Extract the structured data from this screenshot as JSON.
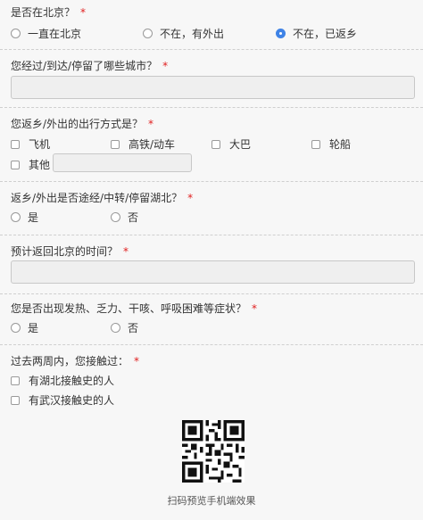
{
  "q1": {
    "title": "是否在北京？",
    "required": "*",
    "options": [
      "一直在北京",
      "不在，有外出",
      "不在，已返乡"
    ]
  },
  "q2": {
    "title": "您经过/到达/停留了哪些城市？",
    "required": "*",
    "value": ""
  },
  "q3": {
    "title": "您返乡/外出的出行方式是？",
    "required": "*",
    "options": [
      "飞机",
      "高铁/动车",
      "大巴",
      "轮船"
    ],
    "other": "其他",
    "other_value": ""
  },
  "q4": {
    "title": "返乡/外出是否途经/中转/停留湖北？",
    "required": "*",
    "options": [
      "是",
      "否"
    ]
  },
  "q5": {
    "title": "预计返回北京的时间？",
    "required": "*",
    "value": ""
  },
  "q6": {
    "title": "您是否出现发热、乏力、干咳、呼吸困难等症状？",
    "required": "*",
    "options": [
      "是",
      "否"
    ]
  },
  "q7": {
    "title": "过去两周内，您接触过：",
    "required": "*",
    "options": [
      "有湖北接触史的人",
      "有武汉接触史的人"
    ]
  },
  "qr": {
    "caption": "扫码预览手机端效果"
  },
  "colors": {
    "accent": "#3f83e6",
    "required": "#e02020"
  }
}
